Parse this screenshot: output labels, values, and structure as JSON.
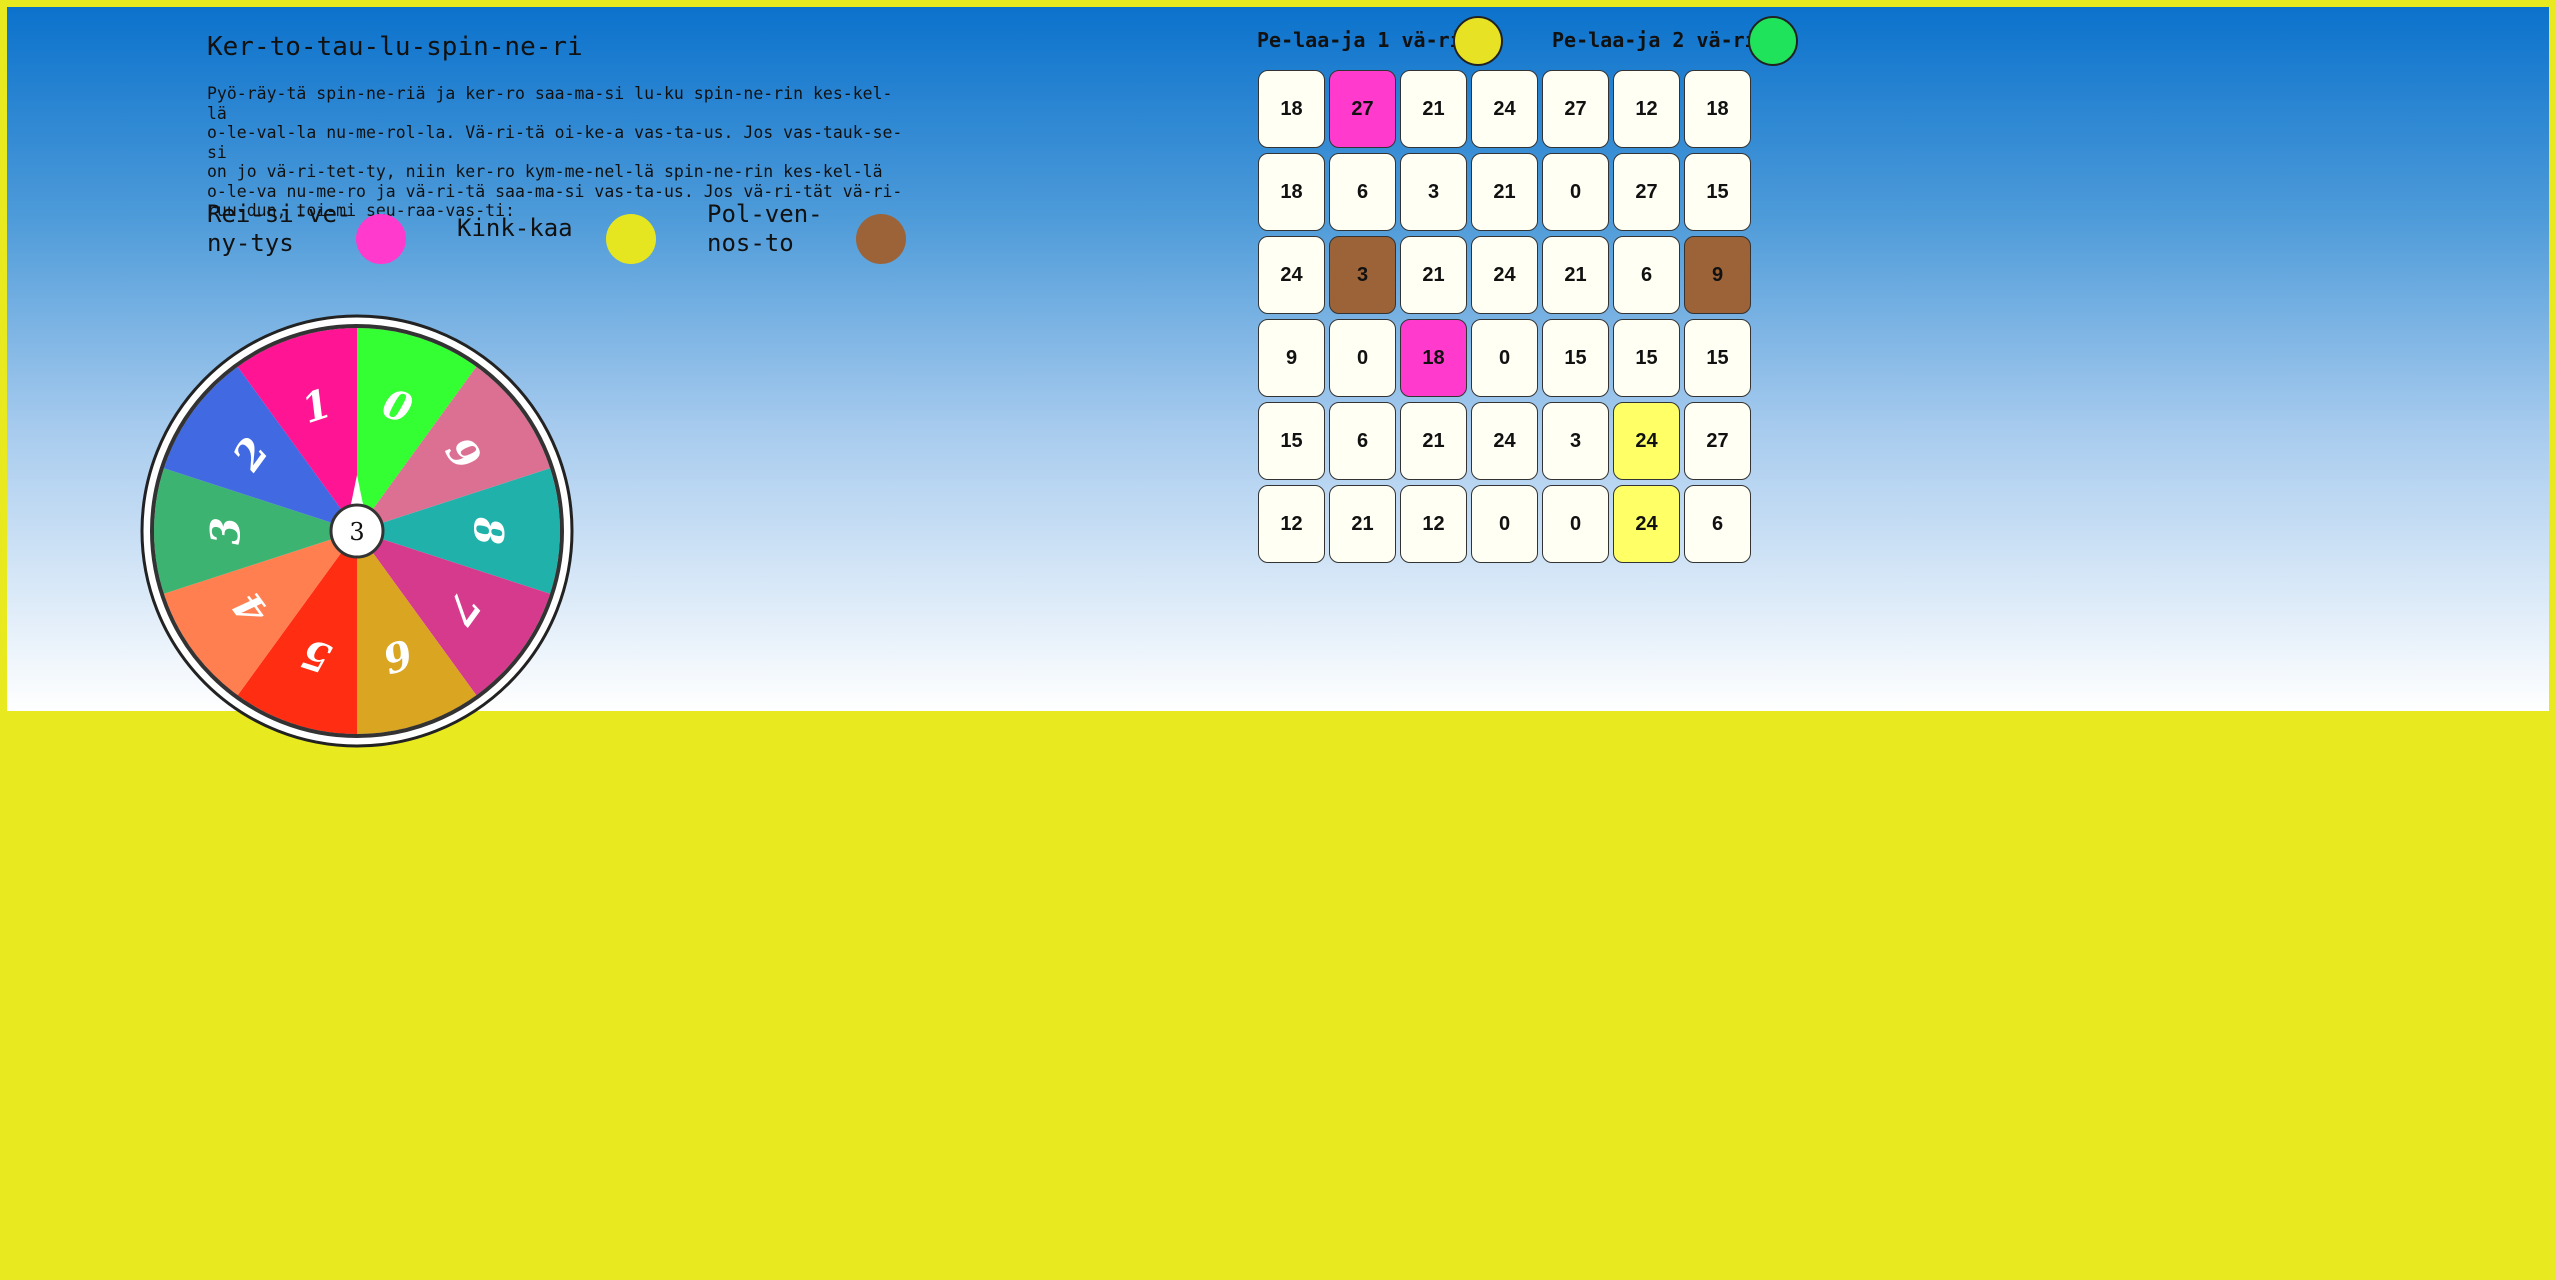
{
  "title": "Ker-to-tau-lu-spin-ne-ri",
  "instructions": [
    "Pyö-räy-tä spin-ne-riä ja ker-ro saa-ma-si lu-ku spin-ne-rin kes-kel-lä",
    "o-le-val-la nu-me-rol-la. Vä-ri-tä oi-ke-a vas-ta-us. Jos vas-tauk-se-si",
    "on jo vä-ri-tet-ty, niin ker-ro kym-me-nel-lä spin-ne-rin kes-kel-lä",
    "o-le-va nu-me-ro ja vä-ri-tä saa-ma-si vas-ta-us. Jos vä-ri-tät vä-ri-",
    "ruu-dun, toi-mi seu-raa-vas-ti:"
  ],
  "legend": [
    {
      "label": "Rei-si-ve-\nny-tys",
      "color": "#ff3acd"
    },
    {
      "label": "Kink-kaa",
      "color": "#e6e620"
    },
    {
      "label": "Pol-ven-\nnos-to",
      "color": "#9b6337"
    }
  ],
  "players": [
    {
      "label": "Pe-laa-ja 1 vä-ri:",
      "color": "#e8e225"
    },
    {
      "label": "Pe-laa-ja 2 vä-ri:",
      "color": "#1fe35b"
    }
  ],
  "spinner": {
    "center_value": "3",
    "segments": [
      {
        "number": "0",
        "color": "#33ff33"
      },
      {
        "number": "9",
        "color": "#db7093"
      },
      {
        "number": "8",
        "color": "#20b2aa"
      },
      {
        "number": "7",
        "color": "#d63a8c"
      },
      {
        "number": "6",
        "color": "#daa520"
      },
      {
        "number": "5",
        "color": "#ff2d12"
      },
      {
        "number": "4",
        "color": "#ff7f50"
      },
      {
        "number": "3",
        "color": "#3cb371"
      },
      {
        "number": "2",
        "color": "#4169e1"
      },
      {
        "number": "1",
        "color": "#ff1493"
      }
    ]
  },
  "board": [
    [
      {
        "v": "18"
      },
      {
        "v": "27",
        "c": "#ff3acd"
      },
      {
        "v": "21"
      },
      {
        "v": "24"
      },
      {
        "v": "27"
      },
      {
        "v": "12"
      },
      {
        "v": "18"
      }
    ],
    [
      {
        "v": "18"
      },
      {
        "v": "6"
      },
      {
        "v": "3"
      },
      {
        "v": "21"
      },
      {
        "v": "0"
      },
      {
        "v": "27"
      },
      {
        "v": "15"
      }
    ],
    [
      {
        "v": "24"
      },
      {
        "v": "3",
        "c": "#9b6337"
      },
      {
        "v": "21"
      },
      {
        "v": "24"
      },
      {
        "v": "21"
      },
      {
        "v": "6"
      },
      {
        "v": "9",
        "c": "#9b6337"
      }
    ],
    [
      {
        "v": "9"
      },
      {
        "v": "0"
      },
      {
        "v": "18",
        "c": "#ff3acd"
      },
      {
        "v": "0"
      },
      {
        "v": "15"
      },
      {
        "v": "15"
      },
      {
        "v": "15"
      }
    ],
    [
      {
        "v": "15"
      },
      {
        "v": "6"
      },
      {
        "v": "21"
      },
      {
        "v": "24"
      },
      {
        "v": "3"
      },
      {
        "v": "24",
        "c": "#ffff66"
      },
      {
        "v": "27"
      }
    ],
    [
      {
        "v": "12"
      },
      {
        "v": "21"
      },
      {
        "v": "12"
      },
      {
        "v": "0"
      },
      {
        "v": "0"
      },
      {
        "v": "24",
        "c": "#ffff66"
      },
      {
        "v": "6"
      }
    ]
  ]
}
